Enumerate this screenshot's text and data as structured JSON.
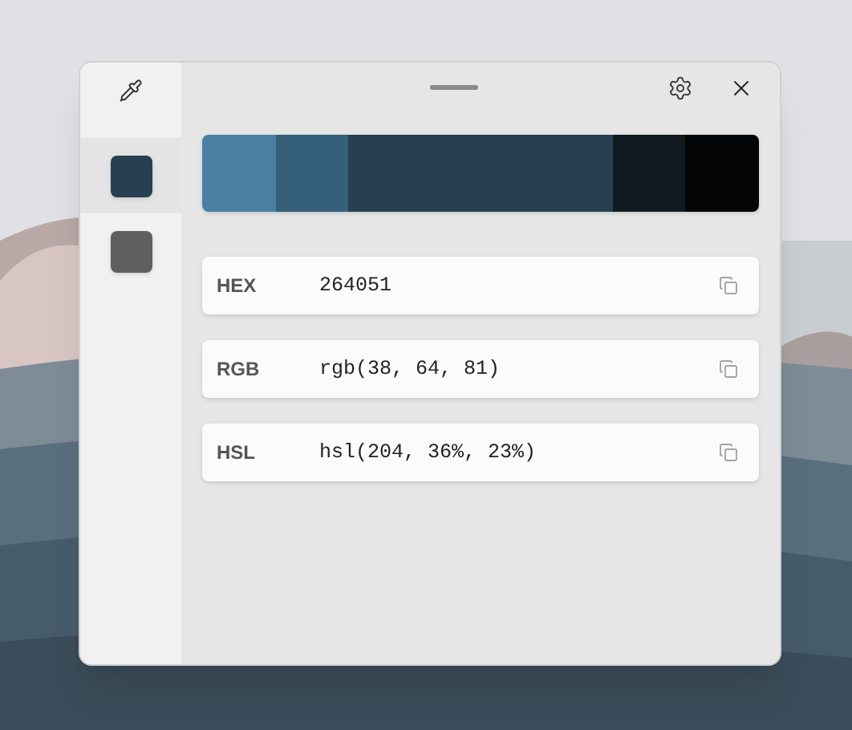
{
  "history": [
    {
      "color": "#264051",
      "selected": true
    },
    {
      "color": "#5f5f5f",
      "selected": false
    }
  ],
  "palette": [
    {
      "color": "#4a7fa3",
      "selected": false
    },
    {
      "color": "#365f7a",
      "selected": false
    },
    {
      "color": "#264051",
      "selected": true
    },
    {
      "color": "#111a21",
      "selected": false
    },
    {
      "color": "#030405",
      "selected": false
    }
  ],
  "formats": [
    {
      "label": "HEX",
      "value": "264051"
    },
    {
      "label": "RGB",
      "value": "rgb(38, 64, 81)"
    },
    {
      "label": "HSL",
      "value": "hsl(204, 36%, 23%)"
    }
  ]
}
